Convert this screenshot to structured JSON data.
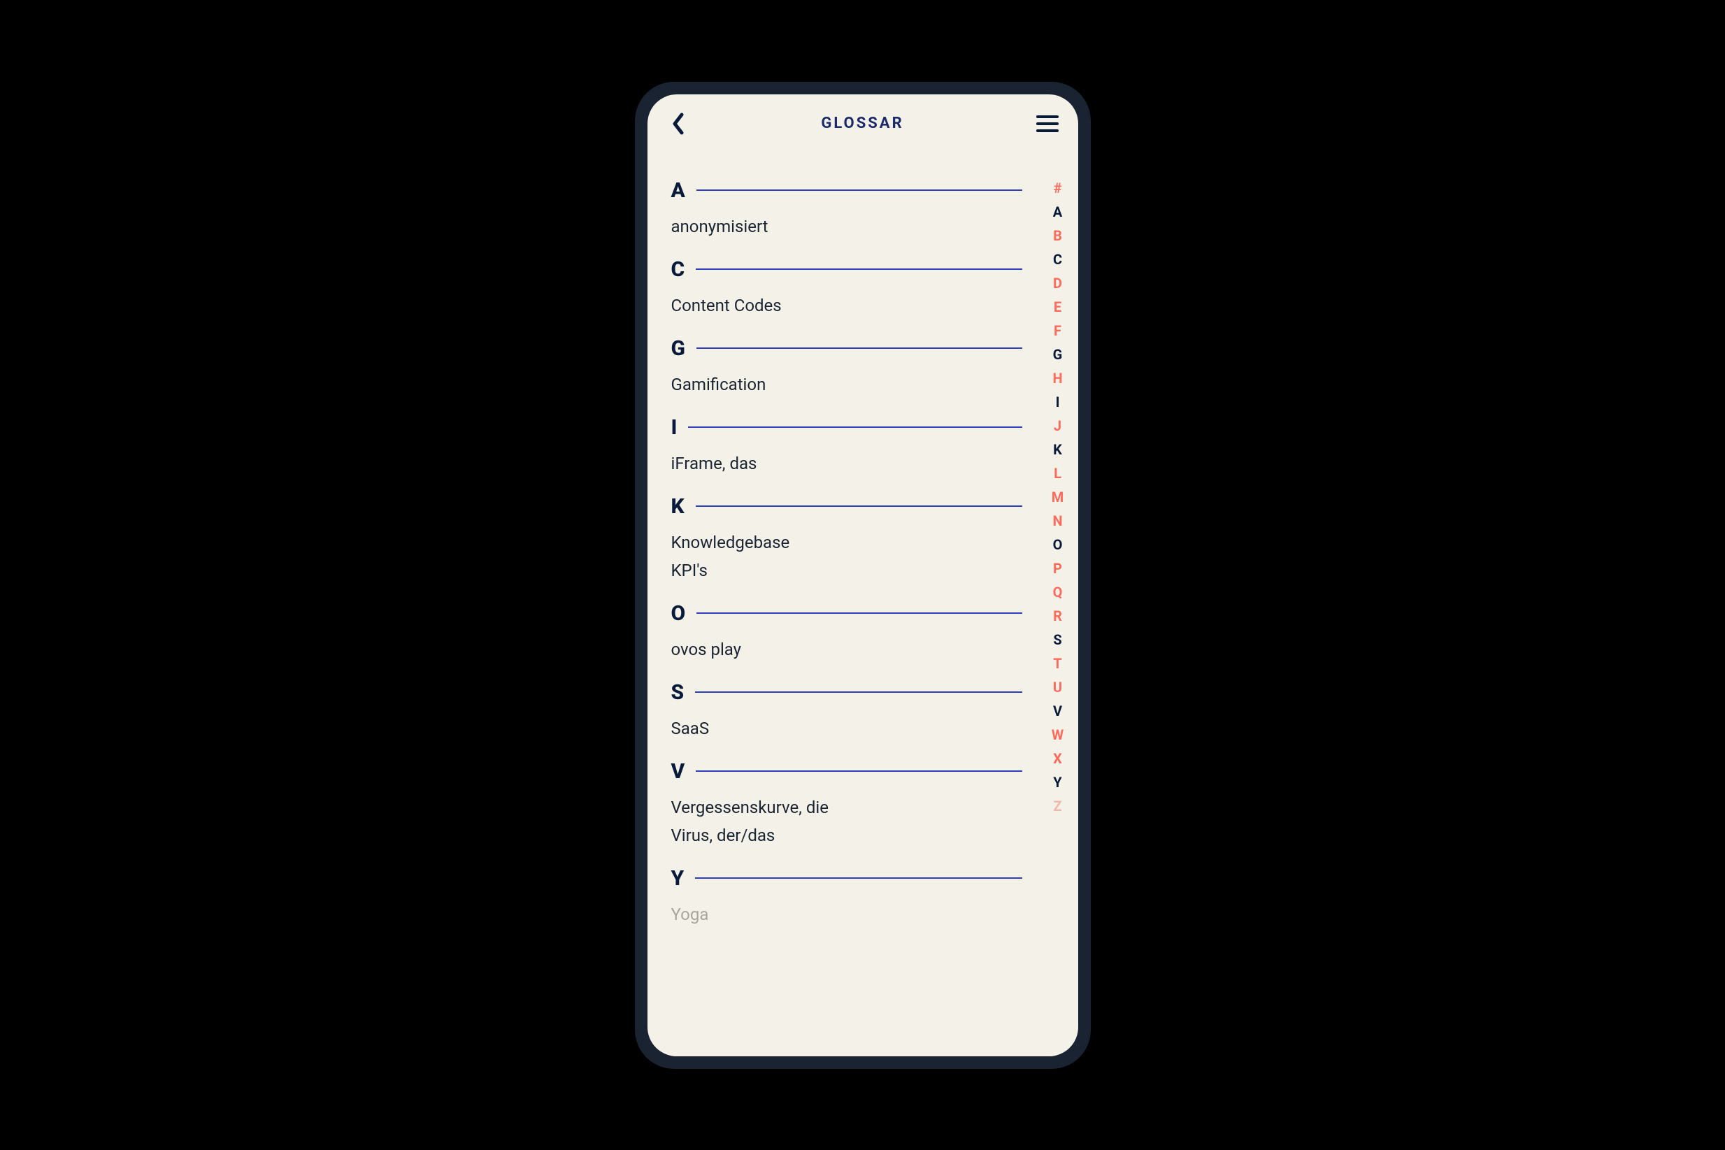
{
  "header": {
    "title": "GLOSSAR"
  },
  "colors": {
    "accent": "#1b2a6b",
    "rule": "#2d3fbf",
    "text": "#0a1a3a",
    "inactive_index": "#ff6b5b",
    "faded": "#a9a79b",
    "bg": "#f4f2e8",
    "frame": "#1a2332"
  },
  "sections": [
    {
      "letter": "A",
      "entries": [
        "anonymisiert"
      ]
    },
    {
      "letter": "C",
      "entries": [
        "Content Codes"
      ]
    },
    {
      "letter": "G",
      "entries": [
        "Gamification"
      ]
    },
    {
      "letter": "I",
      "entries": [
        "iFrame, das"
      ]
    },
    {
      "letter": "K",
      "entries": [
        "Knowledgebase",
        "KPI's"
      ]
    },
    {
      "letter": "O",
      "entries": [
        "ovos play"
      ]
    },
    {
      "letter": "S",
      "entries": [
        "SaaS"
      ]
    },
    {
      "letter": "V",
      "entries": [
        "Vergessenskurve, die",
        "Virus, der/das"
      ]
    },
    {
      "letter": "Y",
      "entries": [
        "Yoga"
      ],
      "faded": true
    }
  ],
  "index": [
    {
      "char": "#",
      "active": false
    },
    {
      "char": "A",
      "active": true
    },
    {
      "char": "B",
      "active": false
    },
    {
      "char": "C",
      "active": true
    },
    {
      "char": "D",
      "active": false
    },
    {
      "char": "E",
      "active": false
    },
    {
      "char": "F",
      "active": false
    },
    {
      "char": "G",
      "active": true
    },
    {
      "char": "H",
      "active": false
    },
    {
      "char": "I",
      "active": true
    },
    {
      "char": "J",
      "active": false
    },
    {
      "char": "K",
      "active": true
    },
    {
      "char": "L",
      "active": false
    },
    {
      "char": "M",
      "active": false
    },
    {
      "char": "N",
      "active": false
    },
    {
      "char": "O",
      "active": true
    },
    {
      "char": "P",
      "active": false
    },
    {
      "char": "Q",
      "active": false
    },
    {
      "char": "R",
      "active": false
    },
    {
      "char": "S",
      "active": true
    },
    {
      "char": "T",
      "active": false
    },
    {
      "char": "U",
      "active": false
    },
    {
      "char": "V",
      "active": true
    },
    {
      "char": "W",
      "active": false
    },
    {
      "char": "X",
      "active": false
    },
    {
      "char": "Y",
      "active": true
    },
    {
      "char": "Z",
      "active": false,
      "faded": true
    }
  ]
}
